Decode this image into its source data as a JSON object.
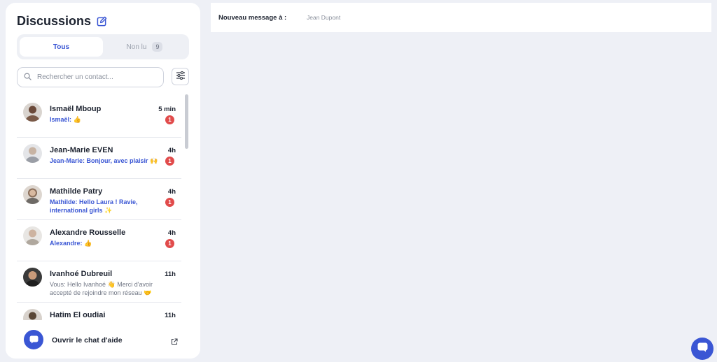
{
  "sidebar": {
    "title": "Discussions",
    "tabs": [
      {
        "label": "Tous"
      },
      {
        "label": "Non lu",
        "count": "9"
      }
    ],
    "search": {
      "placeholder": "Rechercher un contact..."
    },
    "conversations": [
      {
        "name": "Ismaël Mboup",
        "time": "5 min",
        "preview": "Ismaël: 👍",
        "unread": "1",
        "avatar_color": "#6b4a3a"
      },
      {
        "name": "Jean-Marie EVEN",
        "time": "4h",
        "preview": "Jean-Marie: Bonjour, avec plaisir 🙌",
        "unread": "1",
        "avatar_color": "#9a9ea6"
      },
      {
        "name": "Mathilde Patry",
        "time": "4h",
        "preview": "Mathilde: Hello Laura ! Ravie, international girls ✨",
        "unread": "1",
        "avatar_color": "#8a6e5a"
      },
      {
        "name": "Alexandre Rousselle",
        "time": "4h",
        "preview": "Alexandre: 👍",
        "unread": "1",
        "avatar_color": "#b0a89e"
      },
      {
        "name": "Ivanhoé Dubreuil",
        "time": "11h",
        "preview": "Vous: Hello Ivanhoé 👋 Merci d'avoir accepté de rejoindre mon réseau 🤝",
        "unread": "",
        "avatar_color": "#2a2a2a"
      },
      {
        "name": "Hatim El oudiai",
        "time": "11h",
        "preview": "",
        "unread": "",
        "avatar_color": "#5a4636"
      }
    ],
    "help": {
      "label": "Ouvrir le chat d'aide"
    }
  },
  "main": {
    "new_message_label": "Nouveau message à :",
    "recipient": "Jean Dupont"
  },
  "colors": {
    "accent": "#3a56d4",
    "unread_badge": "#e14b4b",
    "background": "#eef0f6"
  }
}
